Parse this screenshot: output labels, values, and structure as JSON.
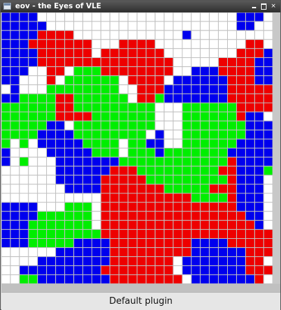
{
  "window": {
    "title": "eov - the Eyes of VLE",
    "controls": {
      "minimize_icon": "minimize-icon",
      "maximize_icon": "maximize-icon",
      "close_icon": "close-icon",
      "close_glyph": "×"
    }
  },
  "status": {
    "text": "Default plugin"
  },
  "grid": {
    "rows": 30,
    "cols": 30,
    "colors": {
      "W": "#ffffff",
      "B": "#0000ee",
      "R": "#ee0000",
      "G": "#00ee00",
      "lines": "#c0c0c0"
    },
    "cells": [
      "BBBBWWWWWWWWWWWWWWWWWWWWWWBBBW",
      "BBBBBWWWWWWWWWWWWWWWWWWWWWBBWW",
      "BBBBRRRRWWWWWWWWWWWWBWWWWWWWWW",
      "BBBRRRRRRRWWWRRRRWWWWWWWWWWRRW",
      "BBBBRRRRRRWRRRRRRRWWWWWWWWRRRB",
      "BBBBRRRRRRRRRRRRRRRWWWWWRRRRBB",
      "BBBWWRRWGGGRRRRRRRRWWBBBRRRRBB",
      "BBWWWRWGGGGGGWRRRRWBBBBBBRRRBB",
      "WBWWWGGGGGGGGWWRRRBBBBBBBRRRRR",
      "BBGGGGRRGGGGGGWRRGBBBBBBBRRRRR",
      "GGGGGGRRGGGGGGGGGWWWGGGGGGRRRR",
      "GGGGGGRRRRGGGGGGGWWWGGGGGGRBBW",
      "GGGGGBBWGGGGGGGGGWWWGGGGGGGBBB",
      "GGGGBBBBGGGGGGGGWBWWGGGGGGGBBB",
      "GWGWBBBBBGGGGWGGBBWWGGGGGGBBBB",
      "BWWWWBBBBBGGGWGGGBGGGGGGGBBBBB",
      "BWGWWWBBBBBBBGGGGGGGGGGGGRBBBB",
      "WWWWWWBBBBBBRRRGGGGGGGGGRRBBBG",
      "WWWWWWBBBBBRRRRRGGGGGGGGGRBBBW",
      "WWWWWWWBBBBRRRRRRRGGGGGRRRBBBW",
      "WWWWWWWWWWWRRRRRRRRRRGGGGRBBBW",
      "BBBBWWWGGGWRRRRRRRRRRRRRRRBBBW",
      "BBBBGGGGGGWRRRRRRRRRRRRRRRRBBW",
      "BBBGGGGGGGWRRRRRRRRRRRRRRRRRBW",
      "BBBGGGGGGGGRRRRRRRRRRRRRRRRRRR",
      "BBBGGGGGBBBBRRRRRRRRRBBBBRRRRR",
      "WWWWWWBBBBBBRRRRRRRRRBBBBBBRRR",
      "WWWWBBBBBBBBRRRRRRRWBBBBBBBRRW",
      "WWBBBBBBBBBRRRRRRRRWBBBBBBBRRR",
      "WWGGBBBBBBBBRRRRRRRRWBBBBBBBRW"
    ]
  }
}
